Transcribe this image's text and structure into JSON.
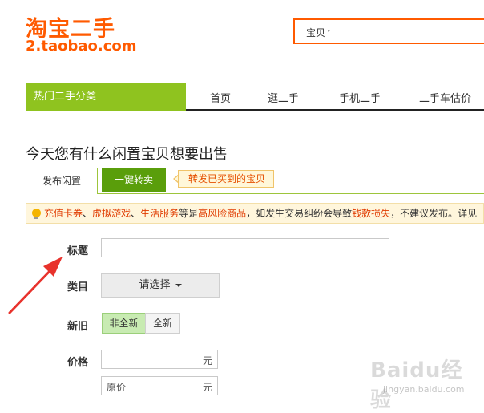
{
  "header": {
    "logo_cn": "淘宝二手",
    "logo_en": "2.taobao.com",
    "search_scope": "宝贝",
    "search_scope_chevron": "˅"
  },
  "nav": {
    "category": "热门二手分类",
    "items": [
      "首页",
      "逛二手",
      "手机二手",
      "二手车估价"
    ]
  },
  "page_title": "今天您有什么闲置宝贝想要出售",
  "tabs": {
    "publish": "发布闲置",
    "quick": "一键转卖",
    "tip": "转发已买到的宝贝"
  },
  "warning": {
    "seg1": "充值卡券",
    "sep1": "、",
    "seg2": "虚拟游戏",
    "sep2": "、",
    "seg3": "生活服务",
    "seg4": "等是",
    "seg5": "高风险商品",
    "seg6": "，如发生交易纠纷会导致",
    "seg7": "钱款损失",
    "seg8": "，不建议发布。详见"
  },
  "form": {
    "title_label": "标题",
    "title_value": "",
    "category_label": "类目",
    "category_select": "请选择",
    "condition_label": "新旧",
    "condition_options": [
      "非全新",
      "全新"
    ],
    "condition_selected": "非全新",
    "price_label": "价格",
    "price_value": "",
    "price_unit": "元",
    "original_price_placeholder": "原价",
    "original_price_unit": "元"
  },
  "watermark": {
    "logo": "Baidu经验",
    "url": "jingyan.baidu.com"
  },
  "colors": {
    "brand_orange": "#ff5a00",
    "nav_green": "#8fc31f",
    "tab_green": "#5a9e0b",
    "warning_red": "#e03b00",
    "arrow_red": "#e8322c"
  }
}
